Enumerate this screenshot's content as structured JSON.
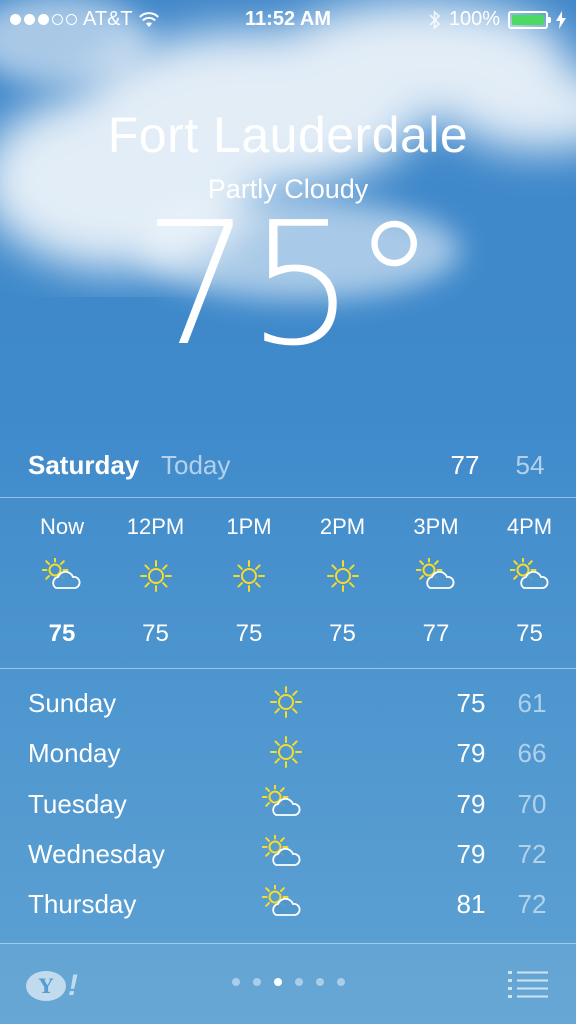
{
  "status_bar": {
    "carrier": "AT&T",
    "signal_bars": 3,
    "time": "11:52 AM",
    "battery": "100%",
    "battery_color": "#4cd964"
  },
  "location": {
    "city": "Fort Lauderdale",
    "condition": "Partly Cloudy",
    "temperature": "75",
    "degree_symbol": "°"
  },
  "today": {
    "day": "Saturday",
    "label": "Today",
    "high": "77",
    "low": "54"
  },
  "hourly": [
    {
      "time": "Now",
      "icon": "partly-cloudy-icon",
      "temp": "75"
    },
    {
      "time": "12PM",
      "icon": "sun-icon",
      "temp": "75"
    },
    {
      "time": "1PM",
      "icon": "sun-icon",
      "temp": "75"
    },
    {
      "time": "2PM",
      "icon": "sun-icon",
      "temp": "75"
    },
    {
      "time": "3PM",
      "icon": "partly-cloudy-icon",
      "temp": "77"
    },
    {
      "time": "4PM",
      "icon": "partly-cloudy-icon",
      "temp": "75"
    }
  ],
  "daily": [
    {
      "day": "Sunday",
      "icon": "sun-icon",
      "high": "75",
      "low": "61"
    },
    {
      "day": "Monday",
      "icon": "sun-icon",
      "high": "79",
      "low": "66"
    },
    {
      "day": "Tuesday",
      "icon": "partly-cloudy-icon",
      "high": "79",
      "low": "70"
    },
    {
      "day": "Wednesday",
      "icon": "partly-cloudy-icon",
      "high": "79",
      "low": "72"
    },
    {
      "day": "Thursday",
      "icon": "partly-cloudy-icon",
      "high": "81",
      "low": "72"
    }
  ],
  "bottom_bar": {
    "logo_letter": "Y",
    "logo_bang": "!",
    "page_count": 6,
    "active_page": 3
  },
  "colors": {
    "sun": "#f3dc2c",
    "sky_top": "#3f86c9",
    "sky_bottom": "#5ea2d3"
  }
}
